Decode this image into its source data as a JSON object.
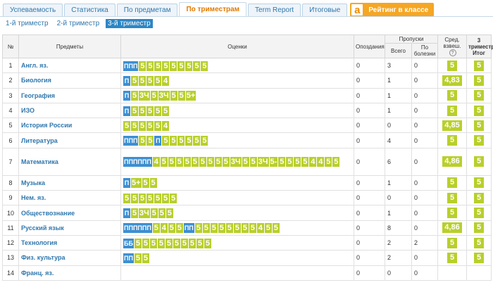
{
  "tabs": [
    {
      "label": "Успеваемость",
      "active": false
    },
    {
      "label": "Статистика",
      "active": false
    },
    {
      "label": "По предметам",
      "active": false
    },
    {
      "label": "По триместрам",
      "active": true
    },
    {
      "label": "Term Report",
      "active": false
    },
    {
      "label": "Итоговые",
      "active": false
    }
  ],
  "rating": {
    "icon_letter": "a",
    "label": "Рейтинг в классе"
  },
  "subtabs": [
    {
      "label": "1-й триместр",
      "active": false
    },
    {
      "label": "2-й триместр",
      "active": false
    },
    {
      "label": "3-й триместр",
      "active": true
    }
  ],
  "headers": {
    "num": "№",
    "subject": "Предметы",
    "grades": "Оценки",
    "late": "Опоздания",
    "absences": "Пропуски",
    "absences_total": "Всего",
    "absences_sick": "По болезни",
    "avg": "Сред. взвеш.",
    "avg_help": "?",
    "final": "3 триместр Итог"
  },
  "colors": {
    "grade": "#b9cf2b",
    "absent_mark": "#3d8fd1",
    "link": "#2f77ad",
    "active_tab": "#e07a00"
  },
  "rows": [
    {
      "num": "1",
      "subject": "Англ. яз.",
      "grades": [
        "ППП",
        "5",
        "5",
        "5",
        "5",
        "5",
        "5",
        "5",
        "5",
        "5"
      ],
      "late": "0",
      "total": "3",
      "sick": "0",
      "avg": "5",
      "final": "5"
    },
    {
      "num": "2",
      "subject": "Биология",
      "grades": [
        "П",
        "5",
        "5",
        "5",
        "5",
        "4"
      ],
      "late": "0",
      "total": "1",
      "sick": "0",
      "avg": "4,83",
      "final": "5"
    },
    {
      "num": "3",
      "subject": "География",
      "grades": [
        "П",
        "5",
        "3Ч",
        "5",
        "3Ч",
        "5",
        "5",
        "5+"
      ],
      "late": "0",
      "total": "1",
      "sick": "0",
      "avg": "5",
      "final": "5"
    },
    {
      "num": "4",
      "subject": "ИЗО",
      "grades": [
        "П",
        "5",
        "5",
        "5",
        "5",
        "5"
      ],
      "late": "0",
      "total": "1",
      "sick": "0",
      "avg": "5",
      "final": "5"
    },
    {
      "num": "5",
      "subject": "История России",
      "grades": [
        "5",
        "5",
        "5",
        "5",
        "5",
        "4"
      ],
      "late": "0",
      "total": "0",
      "sick": "0",
      "avg": "4,85",
      "final": "5"
    },
    {
      "num": "6",
      "subject": "Литература",
      "grades": [
        "ППП",
        "5",
        "5",
        "П",
        "5",
        "5",
        "5",
        "5",
        "5",
        "5"
      ],
      "late": "0",
      "total": "4",
      "sick": "0",
      "avg": "5",
      "final": "5"
    },
    {
      "num": "7",
      "subject": "Математика",
      "tall": true,
      "grades": [
        "ПППППП",
        "4",
        "5",
        "5",
        "5",
        "5",
        "5",
        "5",
        "5",
        "5",
        "5",
        "3Ч",
        "5",
        "5",
        "3Ч",
        "5-",
        "5",
        "5",
        "5",
        "5",
        "4",
        "4",
        "5",
        "5"
      ],
      "late": "0",
      "total": "6",
      "sick": "0",
      "avg": "4,86",
      "final": "5"
    },
    {
      "num": "8",
      "subject": "Музыка",
      "grades": [
        "П",
        "5+",
        "5",
        "5"
      ],
      "late": "0",
      "total": "1",
      "sick": "0",
      "avg": "5",
      "final": "5"
    },
    {
      "num": "9",
      "subject": "Нем. яз.",
      "grades": [
        "5",
        "5",
        "5",
        "5",
        "5",
        "5",
        "5"
      ],
      "late": "0",
      "total": "0",
      "sick": "0",
      "avg": "5",
      "final": "5"
    },
    {
      "num": "10",
      "subject": "Обществознание",
      "grades": [
        "П",
        "5",
        "3Ч",
        "5",
        "5",
        "5"
      ],
      "late": "0",
      "total": "1",
      "sick": "0",
      "avg": "5",
      "final": "5"
    },
    {
      "num": "11",
      "subject": "Русский язык",
      "grades": [
        "ПППППП",
        "5",
        "4",
        "5",
        "5",
        "ПП",
        "5",
        "5",
        "5",
        "5",
        "5",
        "5",
        "5",
        "5",
        "4",
        "5",
        "5"
      ],
      "late": "0",
      "total": "8",
      "sick": "0",
      "avg": "4,86",
      "final": "5"
    },
    {
      "num": "12",
      "subject": "Технология",
      "grades": [
        "ББ",
        "5",
        "5",
        "5",
        "5",
        "5",
        "5",
        "5",
        "5",
        "5",
        "5"
      ],
      "late": "0",
      "total": "2",
      "sick": "2",
      "avg": "5",
      "final": "5"
    },
    {
      "num": "13",
      "subject": "Физ. культура",
      "grades": [
        "ПП",
        "5",
        "5"
      ],
      "late": "0",
      "total": "2",
      "sick": "0",
      "avg": "5",
      "final": "5"
    },
    {
      "num": "14",
      "subject": "Франц. яз.",
      "grades": [],
      "late": "0",
      "total": "0",
      "sick": "0",
      "avg": "",
      "final": ""
    }
  ]
}
